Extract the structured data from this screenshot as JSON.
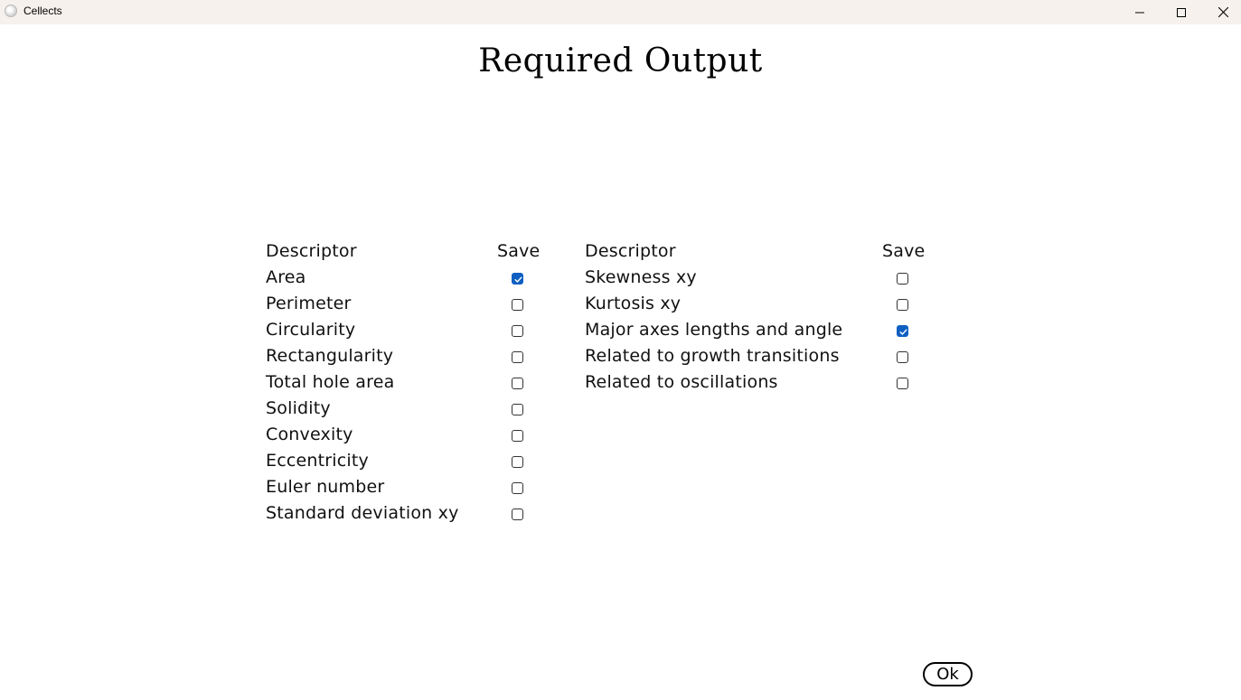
{
  "window": {
    "title": "Cellects",
    "app_icon": "cellects-app-icon",
    "controls": [
      "minimize-icon",
      "maximize-icon",
      "close-icon"
    ]
  },
  "page": {
    "title": "Required Output"
  },
  "left_table": {
    "descriptor_header": "Descriptor",
    "save_header": "Save",
    "rows": [
      {
        "label": "Area",
        "checked": true
      },
      {
        "label": "Perimeter",
        "checked": false
      },
      {
        "label": "Circularity",
        "checked": false
      },
      {
        "label": "Rectangularity",
        "checked": false
      },
      {
        "label": "Total hole area",
        "checked": false
      },
      {
        "label": "Solidity",
        "checked": false
      },
      {
        "label": "Convexity",
        "checked": false
      },
      {
        "label": "Eccentricity",
        "checked": false
      },
      {
        "label": "Euler number",
        "checked": false
      },
      {
        "label": "Standard deviation xy",
        "checked": false
      }
    ]
  },
  "right_table": {
    "descriptor_header": "Descriptor",
    "save_header": "Save",
    "rows": [
      {
        "label": "Skewness xy",
        "checked": false
      },
      {
        "label": "Kurtosis xy",
        "checked": false
      },
      {
        "label": "Major axes lengths and angle",
        "checked": true
      },
      {
        "label": "Related to growth transitions",
        "checked": false
      },
      {
        "label": "Related to oscillations",
        "checked": false
      }
    ]
  },
  "ok_button": {
    "label": "Ok"
  },
  "colors": {
    "titlebar": "#f6f1ed",
    "checkbox_checked": "#0f5fc2"
  }
}
